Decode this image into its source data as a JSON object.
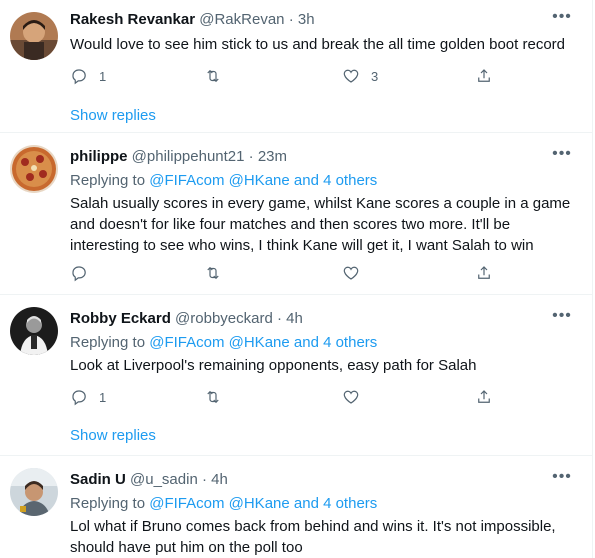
{
  "tweets": [
    {
      "name": "Rakesh Revankar",
      "handle": "@RakRevan",
      "time": "· 3h",
      "text": "Would love to see him stick to us and break the all time golden boot record",
      "reply_count": "1",
      "retweet_count": "",
      "like_count": "3",
      "show_replies": "Show replies"
    },
    {
      "name": "philippe",
      "handle": "@philippehunt21",
      "time": "· 23m",
      "replying_prefix": "Replying to",
      "mention_1": "@FIFAcom",
      "mention_2": "@HKane",
      "and_others": "and 4 others",
      "text": "Salah usually scores in every game, whilst Kane scores a couple in a game and doesn't for like four matches and then scores two more. It'll be interesting to see who wins, I think Kane will get it, I want Salah to win",
      "reply_count": "",
      "retweet_count": "",
      "like_count": ""
    },
    {
      "name": "Robby Eckard",
      "handle": "@robbyeckard",
      "time": "· 4h",
      "replying_prefix": "Replying to",
      "mention_1": "@FIFAcom",
      "mention_2": "@HKane",
      "and_others": "and 4 others",
      "text": "Look at Liverpool's remaining opponents, easy path for Salah",
      "reply_count": "1",
      "retweet_count": "",
      "like_count": "",
      "show_replies": "Show replies"
    },
    {
      "name": "Sadin U",
      "handle": "@u_sadin",
      "time": "· 4h",
      "replying_prefix": "Replying to",
      "mention_1": "@FIFAcom",
      "mention_2": "@HKane",
      "and_others": "and 4 others",
      "text": "Lol what if Bruno comes back from behind and wins it. It's not impossible, should have put him on the poll too"
    }
  ],
  "colors": {
    "accent": "#1d9bf0",
    "muted": "#536471",
    "text": "#0f1419",
    "divider": "#eff3f4"
  },
  "icons": [
    "reply-icon",
    "retweet-icon",
    "like-icon",
    "share-icon",
    "more-options-icon"
  ]
}
